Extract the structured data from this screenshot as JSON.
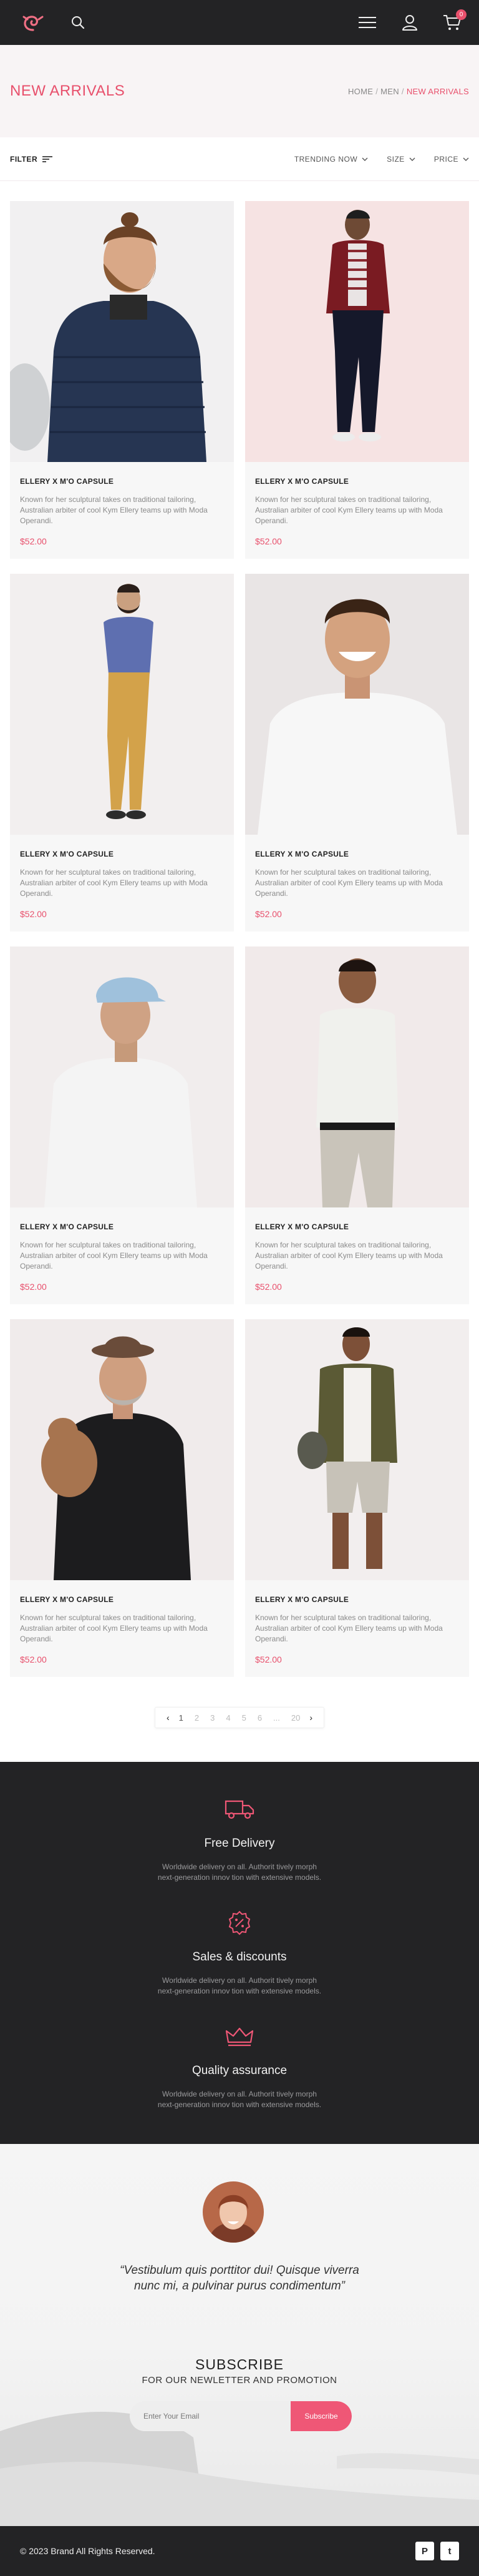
{
  "header": {
    "logo_icon": "spiral-logo-icon",
    "search_icon": "search-icon",
    "menu_icon": "hamburger-menu-icon",
    "account_icon": "user-icon",
    "cart_icon": "cart-icon",
    "cart_count": "0",
    "accent_color": "#e8506c"
  },
  "banner": {
    "title": "NEW ARRIVALS",
    "breadcrumb": [
      "HOME",
      "MEN",
      "NEW ARRIVALS"
    ]
  },
  "filters": {
    "filter_label": "FILTER",
    "sort_options": [
      "TRENDING NOW",
      "SIZE",
      "PRICE"
    ]
  },
  "products": [
    {
      "title": "ELLERY X M'O CAPSULE",
      "description": "Known for her sculptural takes on traditional tailoring, Australian arbiter of cool Kym Ellery teams up with Moda Operandi.",
      "price": "$52.00"
    },
    {
      "title": "ELLERY X M'O CAPSULE",
      "description": "Known for her sculptural takes on traditional tailoring, Australian arbiter of cool Kym Ellery teams up with Moda Operandi.",
      "price": "$52.00"
    },
    {
      "title": "ELLERY X M'O CAPSULE",
      "description": "Known for her sculptural takes on traditional tailoring, Australian arbiter of cool Kym Ellery teams up with Moda Operandi.",
      "price": "$52.00"
    },
    {
      "title": "ELLERY X M'O CAPSULE",
      "description": "Known for her sculptural takes on traditional tailoring, Australian arbiter of cool Kym Ellery teams up with Moda Operandi.",
      "price": "$52.00"
    },
    {
      "title": "ELLERY X M'O CAPSULE",
      "description": "Known for her sculptural takes on traditional tailoring, Australian arbiter of cool Kym Ellery teams up with Moda Operandi.",
      "price": "$52.00"
    },
    {
      "title": "ELLERY X M'O CAPSULE",
      "description": "Known for her sculptural takes on traditional tailoring, Australian arbiter of cool Kym Ellery teams up with Moda Operandi.",
      "price": "$52.00"
    },
    {
      "title": "ELLERY X M'O CAPSULE",
      "description": "Known for her sculptural takes on traditional tailoring, Australian arbiter of cool Kym Ellery teams up with Moda Operandi.",
      "price": "$52.00"
    },
    {
      "title": "ELLERY X M'O CAPSULE",
      "description": "Known for her sculptural takes on traditional tailoring, Australian arbiter of cool Kym Ellery teams up with Moda Operandi.",
      "price": "$52.00"
    }
  ],
  "pagination": {
    "prev": "‹",
    "pages": [
      "1",
      "2",
      "3",
      "4",
      "5",
      "6",
      "...",
      "20"
    ],
    "next": "›",
    "current": "1"
  },
  "features": [
    {
      "icon": "delivery-truck-icon",
      "title": "Free Delivery",
      "description_line1": "Worldwide delivery on all. Authorit tively morph",
      "description_line2": "next-generation innov tion with extensive models."
    },
    {
      "icon": "percent-discount-icon",
      "title": "Sales & discounts",
      "description_line1": "Worldwide delivery on all. Authorit tively morph",
      "description_line2": "next-generation innov tion with extensive models."
    },
    {
      "icon": "crown-icon",
      "title": "Quality assurance",
      "description_line1": "Worldwide delivery on all. Authorit tively morph",
      "description_line2": "next-generation innov tion with extensive models."
    }
  ],
  "testimonial": {
    "quote": "“Vestibulum quis porttitor dui! Quisque viverra nunc mi, a pulvinar purus condimentum”"
  },
  "newsletter": {
    "title": "SUBSCRIBE",
    "subtitle": "FOR OUR NEWLETTER AND PROMOTION",
    "email_placeholder": "Enter Your Email",
    "button_label": "Subscribe"
  },
  "footer": {
    "copyright": "© 2023  Brand  All Rights Reserved.",
    "social": [
      {
        "icon": "pinterest-icon",
        "glyph": "P"
      },
      {
        "icon": "twitter-icon",
        "glyph": "t"
      }
    ]
  }
}
